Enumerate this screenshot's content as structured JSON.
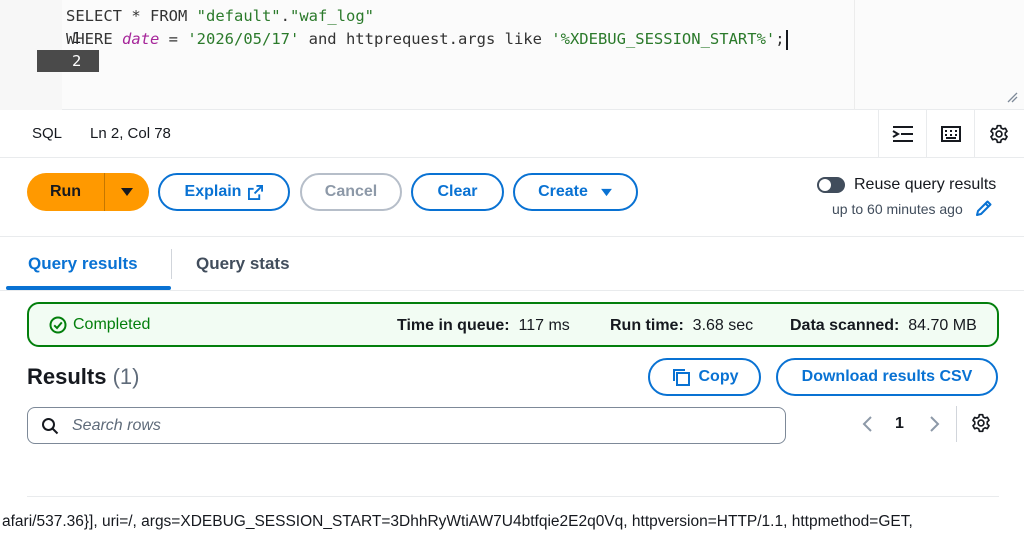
{
  "editor": {
    "lines": [
      {
        "number": "1",
        "parts": [
          {
            "t": "SELECT * FROM ",
            "c": "kw"
          },
          {
            "t": "\"default\"",
            "c": "str"
          },
          {
            "t": ".",
            "c": "kw"
          },
          {
            "t": "\"waf_log\"",
            "c": "str"
          }
        ]
      },
      {
        "number": "2",
        "parts": [
          {
            "t": "WHERE ",
            "c": "kw"
          },
          {
            "t": "date",
            "c": "ident"
          },
          {
            "t": " = ",
            "c": "kw"
          },
          {
            "t": "'2026/05/17'",
            "c": "str"
          },
          {
            "t": " and httprequest.args like ",
            "c": "kw"
          },
          {
            "t": "'%XDEBUG_SESSION_START%'",
            "c": "str"
          },
          {
            "t": ";",
            "c": "kw"
          }
        ]
      }
    ]
  },
  "statusbar": {
    "language": "SQL",
    "cursor_position": "Ln 2, Col 78",
    "icons": [
      "indent-icon",
      "keyboard-icon",
      "gear-icon"
    ]
  },
  "actions": {
    "run_label": "Run",
    "explain_label": "Explain",
    "cancel_label": "Cancel",
    "clear_label": "Clear",
    "create_label": "Create",
    "reuse_label": "Reuse query results",
    "reuse_sub": "up to 60 minutes ago",
    "reuse_enabled": false
  },
  "tabs": [
    {
      "label": "Query results",
      "active": true
    },
    {
      "label": "Query stats",
      "active": false
    }
  ],
  "status": {
    "state": "Completed",
    "queue_label": "Time in queue:",
    "queue_value": "117 ms",
    "run_label": "Run time:",
    "run_value": "3.68 sec",
    "scanned_label": "Data scanned:",
    "scanned_value": "84.70 MB"
  },
  "results": {
    "title": "Results",
    "count": "(1)",
    "copy_label": "Copy",
    "download_label": "Download results CSV",
    "search_placeholder": "Search rows",
    "page": "1",
    "row_text": "afari/537.36}], uri=/, args=XDEBUG_SESSION_START=3DhhRyWtiAW7U4btfqie2E2q0Vq, httpversion=HTTP/1.1, httpmethod=GET,"
  },
  "colors": {
    "accent": "#0972d3",
    "run": "#ff9900",
    "success": "#037f0c"
  }
}
